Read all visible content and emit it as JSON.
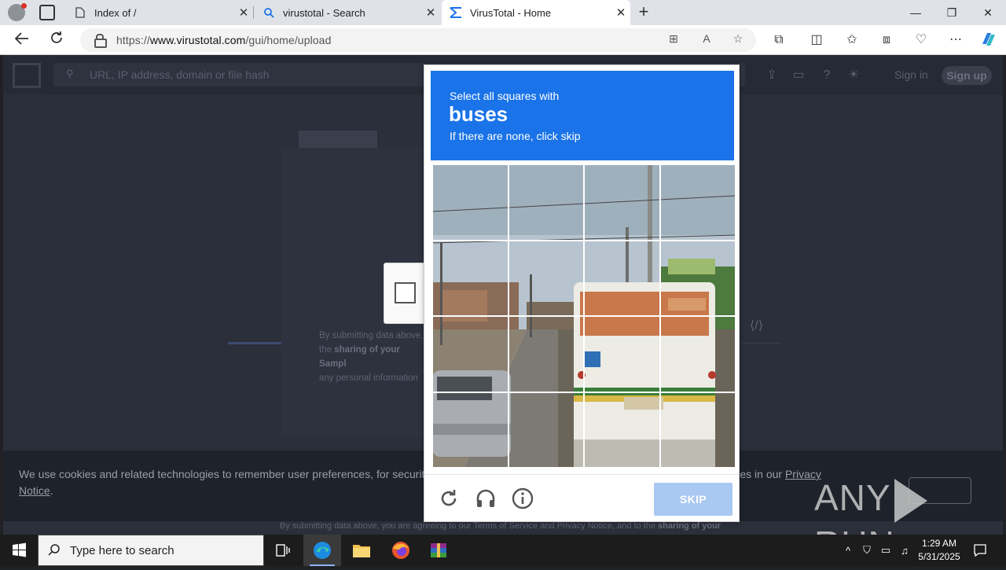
{
  "browser": {
    "tabs": [
      {
        "label": "Index of /",
        "icon": "page-icon",
        "active": false
      },
      {
        "label": "virustotal - Search",
        "icon": "search-icon",
        "active": false
      },
      {
        "label": "VirusTotal - Home",
        "icon": "virustotal-icon",
        "active": true
      }
    ],
    "url_prefix": "https://",
    "url_host": "www.virustotal.com",
    "url_path": "/gui/home/upload"
  },
  "page": {
    "search_placeholder": "URL, IP address, domain or file hash",
    "signin": "Sign in",
    "signup": "Sign up",
    "fine_print_1": "By submitting data above,",
    "fine_print_2_pre": "the ",
    "fine_print_2_bold": "sharing of your Sampl",
    "fine_print_3": "any personal information",
    "bottom_pre": "By submitting data above, you are agreeing to our ",
    "bottom_tos": "Terms of Service",
    "bottom_and": " and ",
    "bottom_privacy": "Privacy Notice",
    "bottom_post": ", and to the ",
    "bottom_bold": "sharing of your"
  },
  "cookie_banner": {
    "text_pre": "We use cookies and related technologies to remember user preferences, for security, to",
    "text_mid": "about cookies in our ",
    "link_1": "Privacy",
    "link_2": "Notice",
    "text_end": "."
  },
  "captcha": {
    "instruction": "Select all squares with",
    "object": "buses",
    "hint": "If there are none, click skip",
    "skip_label": "SKIP",
    "grid_size": 4
  },
  "watermark": {
    "left": "ANY",
    "right": "RUN"
  },
  "taskbar": {
    "search_placeholder": "Type here to search",
    "time": "1:29 AM",
    "date": "5/31/2025"
  }
}
